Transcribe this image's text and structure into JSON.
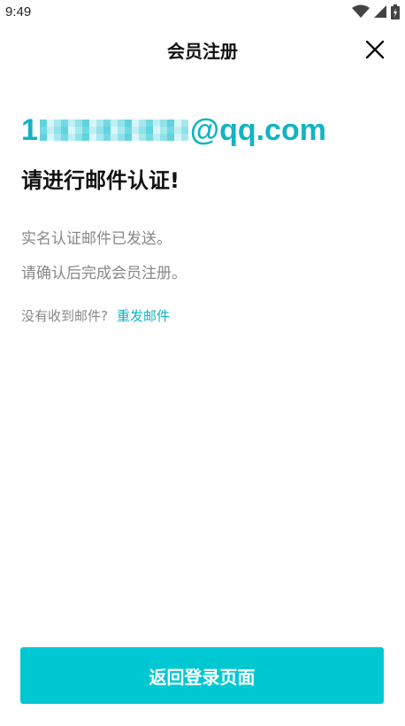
{
  "status_bar": {
    "time": "9:49",
    "icons": [
      "wifi-icon",
      "signal-icon",
      "battery-icon"
    ]
  },
  "header": {
    "title": "会员注册",
    "close_icon": "close-icon"
  },
  "email": {
    "prefix": "1",
    "suffix": "@qq.com",
    "color": "#12b3c4"
  },
  "main": {
    "heading": "请进行邮件认证!",
    "desc_line1": "实名认证邮件已发送。",
    "desc_line2": "请确认后完成会员注册。",
    "resend_question": "没有收到邮件?",
    "resend_link": "重发邮件"
  },
  "footer": {
    "button_label": "返回登录页面",
    "button_color": "#00c8d3"
  }
}
